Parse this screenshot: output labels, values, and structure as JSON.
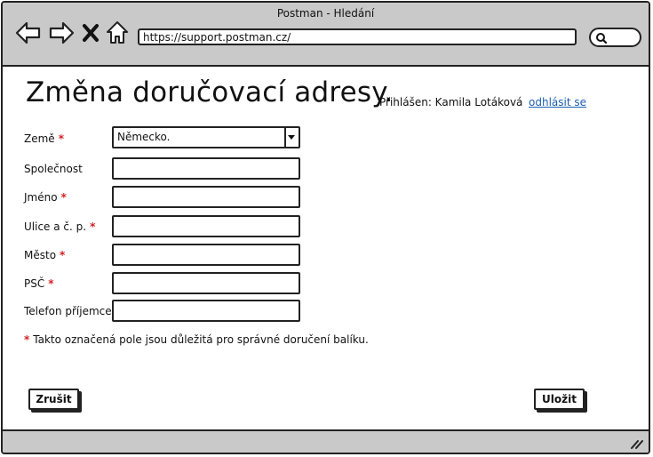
{
  "window": {
    "title": "Postman - Hledání"
  },
  "browser": {
    "url": "https://support.postman.cz/",
    "icons": [
      "back-icon",
      "forward-icon",
      "stop-icon",
      "home-icon",
      "search-icon"
    ]
  },
  "page": {
    "heading": "Změna doručovací adresy.",
    "logged_in": "Přihlášen: Kamila Lotáková",
    "logout": "odhlásit se"
  },
  "form": {
    "required_mark": "*",
    "fields": [
      {
        "label": "Země",
        "required": true,
        "value": "Německo."
      },
      {
        "label": "Společnost",
        "required": false,
        "value": ""
      },
      {
        "label": "Jméno",
        "required": true,
        "value": ""
      },
      {
        "label": "Ulice a č. p.",
        "required": true,
        "value": ""
      },
      {
        "label": "Město",
        "required": true,
        "value": ""
      },
      {
        "label": "PSČ",
        "required": true,
        "value": ""
      },
      {
        "label": "Telefon příjemce",
        "required": false,
        "value": ""
      }
    ],
    "note": "Takto označená pole jsou důležitá pro správné doručení balíku."
  },
  "buttons": {
    "cancel": "Zrušit",
    "save": "Uložit"
  },
  "colors": {
    "chrome": "#c9c9c9",
    "required": "#d42020",
    "link": "#1c5fb3"
  }
}
